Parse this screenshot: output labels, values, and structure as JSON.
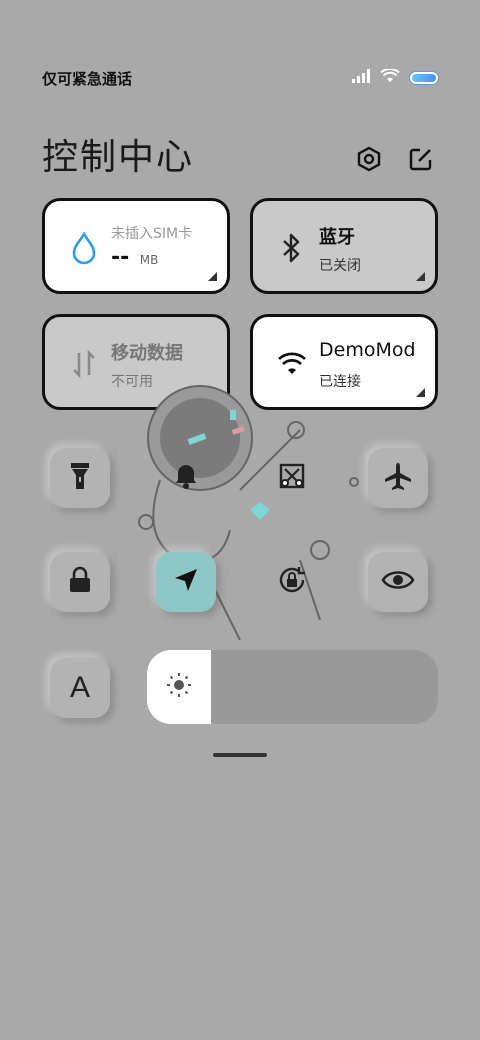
{
  "status_bar": {
    "carrier_text": "仅可紧急通话",
    "icons": [
      "signal-icon",
      "wifi-icon",
      "battery-icon"
    ]
  },
  "header": {
    "title": "控制中心",
    "icons": [
      "settings-icon",
      "edit-icon"
    ]
  },
  "tiles": {
    "data_usage": {
      "line1": "未插入SIM卡",
      "value": "--",
      "unit": "MB",
      "icon": "water-drop-icon"
    },
    "bluetooth": {
      "label": "蓝牙",
      "status": "已关闭",
      "icon": "bluetooth-icon"
    },
    "mobile_data": {
      "label": "移动数据",
      "status": "不可用",
      "icon": "data-arrows-icon"
    },
    "wifi": {
      "label": "DemoMod",
      "status": "已连接",
      "icon": "wifi-icon"
    }
  },
  "toggles_row1": [
    "flashlight-icon",
    "bell-icon",
    "screenshot-icon",
    "airplane-icon"
  ],
  "toggles_row2": [
    "lock-icon",
    "location-icon",
    "rotation-lock-icon",
    "eye-icon"
  ],
  "toggles_row3": [
    "font-a-icon"
  ],
  "font_toggle_label": "A",
  "brightness": {
    "level": 0.22,
    "icon": "sun-icon"
  },
  "colors": {
    "accent_active": "#8ec8c6",
    "background": "#a9a9a9",
    "wifi_blue": "#3aa0f0"
  }
}
